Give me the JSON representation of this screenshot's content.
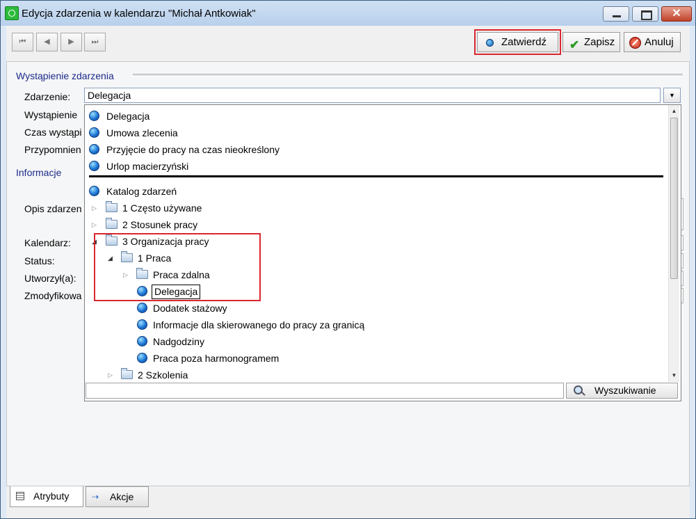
{
  "window": {
    "title": "Edycja zdarzenia w kalendarzu \"Michał Antkowiak\""
  },
  "toolbar": {
    "nav": [
      "⏮",
      "◀",
      "▶",
      "⏭"
    ],
    "confirm_label": "Zatwierdź",
    "save_label": "Zapisz",
    "cancel_label": "Anuluj"
  },
  "section_occurrence": {
    "title": "Wystąpienie zdarzenia",
    "event_label": "Zdarzenie:",
    "event_value": "Delegacja",
    "occurrence_label": "Wystąpienie",
    "time_label": "Czas wystąpi",
    "reminder_label": "Przypomnien"
  },
  "section_info": {
    "title": "Informacje",
    "description_label": "Opis zdarzen",
    "calendar_label": "Kalendarz:",
    "status_label": "Status:",
    "created_label": "Utworzył(a):",
    "modified_label": "Zmodyfikowa"
  },
  "dropdown": {
    "recent": [
      "Delegacja",
      "Umowa zlecenia",
      "Przyjęcie do pracy na czas nieokreślony",
      "Urlop macierzyński"
    ],
    "catalog_label": "Katalog zdarzeń",
    "tree": {
      "folder1": "1 Często używane",
      "folder2": "2 Stosunek pracy",
      "folder3": "3 Organizacja pracy",
      "sub1": "1 Praca",
      "sub1_folder": "Praca zdalna",
      "items": [
        "Delegacja",
        "Dodatek stażowy",
        "Informacje dla skierowanego do pracy za granicą",
        "Nadgodziny",
        "Praca poza harmonogramem"
      ],
      "sub2": "2 Szkolenia"
    },
    "search_value": "",
    "search_button": "Wyszukiwanie"
  },
  "tabs": [
    {
      "label": "Atrybuty",
      "icon": "attributes-icon"
    },
    {
      "label": "Akcje",
      "icon": "actions-icon"
    }
  ],
  "colors": {
    "highlight": "#d9262f",
    "section_title": "#1c2a8a",
    "window_bg": "#dfe9f5"
  }
}
